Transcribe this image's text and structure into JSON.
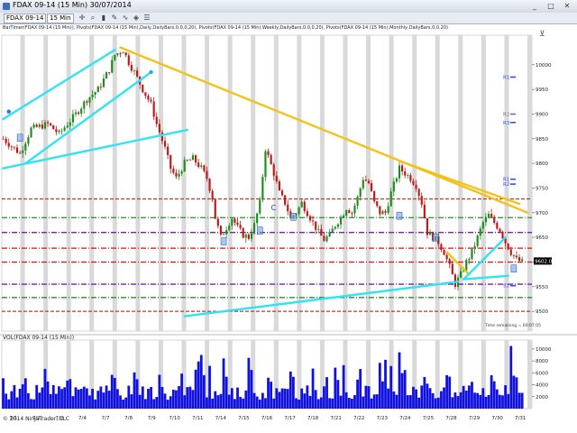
{
  "window": {
    "title": "FDAX 09-14 (15 Min)  30/07/2014",
    "minimize": "_",
    "maximize": "□",
    "close": "✕"
  },
  "toolbar": {
    "instrument": "FDAX 09-14",
    "interval": "15 Min",
    "icons": [
      "crosshair-icon",
      "zoom-icon",
      "bar-type-icon",
      "drawing-icon",
      "indicator-icon",
      "strategy-icon",
      "properties-icon"
    ]
  },
  "indicator_line": "BarTimer(FDAX 09-14 (15 Min)), Pivots(FDAX 09-14 (15 Min),Daily,DailyBars,0,0,0,20), Pivots(FDAX 09-14 (15 Min),Weekly,DailyBars,0,0,0,20), Pivots(FDAX 09-14 (15 Min),Monthly,DailyBars,0,0,20)",
  "volume_label": "VOL(FDAX 09-14 (15 Min))",
  "copyright": "© 2014 NinjaTrader, LLC",
  "bar_timer_text": "Time remaining = 00:07:05",
  "current_price": "9602.0",
  "annotation": "C",
  "colors": {
    "up": "#1e8c1e",
    "down": "#c01818",
    "volume": "#1010e0",
    "trend_yellow": "#f2c21b",
    "trend_cyan": "#31e3f5",
    "axis_bg": "#ffffff"
  },
  "chart_data": {
    "type": "candlestick",
    "dates": [
      "7/1",
      "7/2",
      "7/3",
      "7/4",
      "7/7",
      "7/8",
      "7/9",
      "7/10",
      "7/11",
      "7/14",
      "7/15",
      "7/16",
      "7/17",
      "7/18",
      "7/21",
      "7/22",
      "7/23",
      "7/24",
      "7/25",
      "7/28",
      "7/29",
      "7/30",
      "7/31"
    ],
    "price_ylim": [
      9460,
      10060
    ],
    "price_ticks": [
      10000,
      9950,
      9900,
      9850,
      9800,
      9750,
      9700,
      9650,
      9600,
      9550,
      9500
    ],
    "volume_ylim": [
      0,
      11500
    ],
    "volume_ticks": [
      10000,
      8000,
      6000,
      4000,
      2000
    ],
    "close_path": [
      [
        0,
        9850
      ],
      [
        6,
        9820
      ],
      [
        10,
        9870
      ],
      [
        16,
        9880
      ],
      [
        20,
        9860
      ],
      [
        26,
        9900
      ],
      [
        30,
        9930
      ],
      [
        34,
        9950
      ],
      [
        38,
        9990
      ],
      [
        40,
        10020
      ],
      [
        43,
        10030
      ],
      [
        45,
        10005
      ],
      [
        47,
        9985
      ],
      [
        50,
        9950
      ],
      [
        53,
        9920
      ],
      [
        55,
        9880
      ],
      [
        58,
        9830
      ],
      [
        60,
        9790
      ],
      [
        62,
        9770
      ],
      [
        65,
        9800
      ],
      [
        68,
        9810
      ],
      [
        71,
        9790
      ],
      [
        73,
        9770
      ],
      [
        75,
        9730
      ],
      [
        76,
        9690
      ],
      [
        78,
        9650
      ],
      [
        80,
        9670
      ],
      [
        82,
        9690
      ],
      [
        84,
        9670
      ],
      [
        86,
        9655
      ],
      [
        88,
        9650
      ],
      [
        90,
        9675
      ],
      [
        92,
        9720
      ],
      [
        94,
        9830
      ],
      [
        97,
        9780
      ],
      [
        99,
        9740
      ],
      [
        101,
        9720
      ],
      [
        103,
        9690
      ],
      [
        105,
        9700
      ],
      [
        107,
        9720
      ],
      [
        109,
        9700
      ],
      [
        111,
        9680
      ],
      [
        113,
        9660
      ],
      [
        115,
        9645
      ],
      [
        117,
        9655
      ],
      [
        119,
        9675
      ],
      [
        121,
        9690
      ],
      [
        123,
        9710
      ],
      [
        125,
        9700
      ],
      [
        127,
        9730
      ],
      [
        129,
        9770
      ],
      [
        131,
        9760
      ],
      [
        133,
        9720
      ],
      [
        135,
        9700
      ],
      [
        137,
        9700
      ],
      [
        139,
        9740
      ],
      [
        142,
        9790
      ],
      [
        144,
        9780
      ],
      [
        146,
        9770
      ],
      [
        148,
        9755
      ],
      [
        150,
        9720
      ],
      [
        152,
        9660
      ],
      [
        154,
        9650
      ],
      [
        156,
        9640
      ],
      [
        158,
        9620
      ],
      [
        160,
        9590
      ],
      [
        162,
        9555
      ],
      [
        164,
        9575
      ],
      [
        166,
        9600
      ],
      [
        168,
        9620
      ],
      [
        170,
        9650
      ],
      [
        172,
        9680
      ],
      [
        174,
        9695
      ],
      [
        176,
        9680
      ],
      [
        178,
        9665
      ],
      [
        180,
        9640
      ],
      [
        182,
        9620
      ],
      [
        184,
        9605
      ],
      [
        186,
        9600
      ]
    ],
    "horizontal_levels": [
      {
        "price": 9728,
        "color": "#c0392b",
        "style": "dash"
      },
      {
        "price": 9690,
        "color": "#2e8b2e",
        "style": "dashdot"
      },
      {
        "price": 9660,
        "color": "#7b1fa2",
        "style": "dashdot"
      },
      {
        "price": 9628,
        "color": "#e01010",
        "style": "dashdot"
      },
      {
        "price": 9600,
        "color": "#e01010",
        "style": "dashdot"
      },
      {
        "price": 9555,
        "color": "#7b1fa2",
        "style": "dashdot"
      },
      {
        "price": 9528,
        "color": "#2e8b2e",
        "style": "dashdot"
      },
      {
        "price": 9500,
        "color": "#c0392b",
        "style": "dash"
      }
    ],
    "pivot_labels": [
      {
        "text": "R1",
        "price": 9975,
        "color": "#3050ff"
      },
      {
        "text": "R2",
        "price": 9900,
        "color": "#7070a0"
      },
      {
        "text": "R3",
        "price": 9883,
        "color": "#3050ff"
      },
      {
        "text": "R1",
        "price": 9768,
        "color": "#3050ff"
      },
      {
        "text": "R2",
        "price": 9758,
        "color": "#3050ff"
      },
      {
        "text": "S1",
        "price": 9552,
        "color": "#3050ff"
      }
    ],
    "trendlines": [
      {
        "color": "yellow",
        "from": [
          42,
          10035
        ],
        "to": [
          188,
          9700
        ]
      },
      {
        "color": "yellow",
        "from": [
          142,
          9805
        ],
        "to": [
          185,
          9718
        ]
      },
      {
        "color": "yellow",
        "from": [
          159,
          9620
        ],
        "to": [
          167,
          9575
        ]
      },
      {
        "color": "cyan",
        "from": [
          0,
          9890
        ],
        "to": [
          40,
          10030
        ]
      },
      {
        "color": "cyan",
        "from": [
          0,
          9790
        ],
        "to": [
          66,
          9868
        ]
      },
      {
        "color": "cyan",
        "from": [
          8,
          9800
        ],
        "to": [
          53,
          9985
        ]
      },
      {
        "color": "cyan",
        "from": [
          65,
          9490
        ],
        "to": [
          163,
          9560
        ]
      },
      {
        "color": "cyan",
        "from": [
          165,
          9565
        ],
        "to": [
          180,
          9650
        ]
      },
      {
        "color": "cyan",
        "from": [
          165,
          9565
        ],
        "to": [
          181,
          9572
        ]
      }
    ]
  }
}
